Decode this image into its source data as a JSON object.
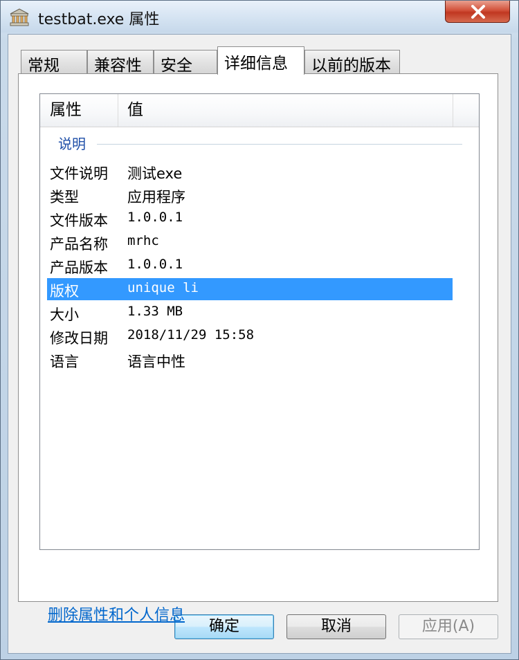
{
  "window": {
    "title": "testbat.exe 属性"
  },
  "tabs": [
    {
      "label": "常规"
    },
    {
      "label": "兼容性"
    },
    {
      "label": "安全"
    },
    {
      "label": "详细信息"
    },
    {
      "label": "以前的版本"
    }
  ],
  "details": {
    "columns": {
      "property": "属性",
      "value": "值"
    },
    "group": "说明",
    "rows": [
      {
        "key": "文件说明",
        "value": "测试exe"
      },
      {
        "key": "类型",
        "value": "应用程序"
      },
      {
        "key": "文件版本",
        "value": "1.0.0.1"
      },
      {
        "key": "产品名称",
        "value": "mrhc"
      },
      {
        "key": "产品版本",
        "value": "1.0.0.1"
      },
      {
        "key": "版权",
        "value": "unique li"
      },
      {
        "key": "大小",
        "value": "1.33 MB"
      },
      {
        "key": "修改日期",
        "value": "2018/11/29 15:58"
      },
      {
        "key": "语言",
        "value": "语言中性"
      }
    ],
    "selected_row": "版权"
  },
  "remove_link": "删除属性和个人信息",
  "buttons": {
    "ok": "确定",
    "cancel": "取消",
    "apply": "应用(A)"
  },
  "colors": {
    "selection": "#3399ff",
    "link": "#0066cc",
    "close": "#c03721"
  },
  "icons": {
    "app": "file-properties-icon",
    "close": "close-icon"
  }
}
